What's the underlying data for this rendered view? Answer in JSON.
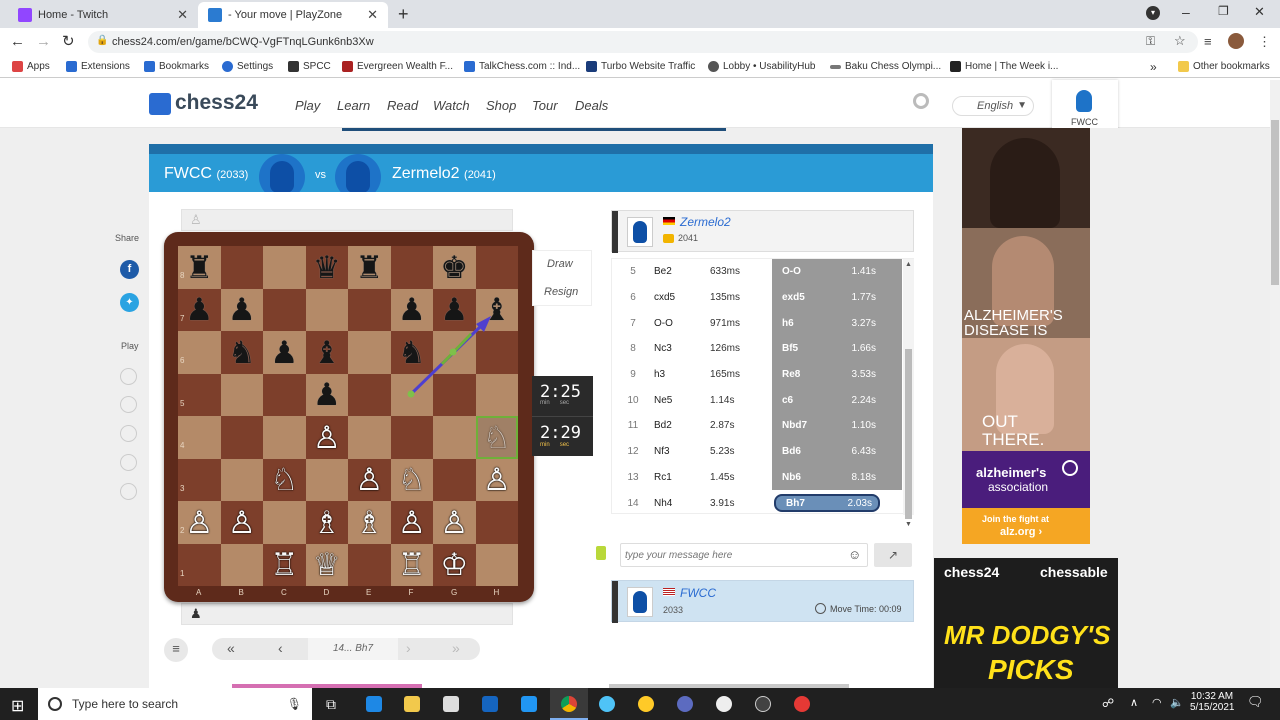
{
  "browser": {
    "tabs": [
      {
        "title": "Home - Twitch",
        "color": "#9146ff"
      },
      {
        "title": "- Your move | PlayZone",
        "color": "#2b7bd1"
      }
    ],
    "new_tab": "+",
    "url": "chess24.com/en/game/bCWQ-VgFTnqLGunk6nb3Xw",
    "bookmarks": [
      "Apps",
      "Extensions",
      "Bookmarks",
      "Settings",
      "SPCC",
      "Evergreen Wealth F...",
      "TalkChess.com :: Ind...",
      "Turbo Website Traffic",
      "Lobby • UsabilityHub",
      "Baku Chess Olympi...",
      "Home | The Week i..."
    ],
    "other_bookmarks": "Other bookmarks",
    "overflow": "»"
  },
  "site": {
    "logo": "chess24",
    "nav": [
      "Play",
      "Learn",
      "Read",
      "Watch",
      "Shop",
      "Tour",
      "Deals"
    ],
    "language": "English",
    "user": "FWCC"
  },
  "game": {
    "white": {
      "name": "FWCC",
      "rating": "(2033)"
    },
    "vs": "vs",
    "black": {
      "name": "Zermelo2",
      "rating": "(2041)"
    },
    "actions": [
      "Draw",
      "Resign"
    ],
    "share_label": "Share",
    "play_label": "Play",
    "clock_top": {
      "min": "2",
      "sec": "25"
    },
    "clock_bottom": {
      "min": "2",
      "sec": "29"
    },
    "min_label": "min",
    "sec_label": "sec",
    "current_move": "14... Bh7",
    "files": [
      "A",
      "B",
      "C",
      "D",
      "E",
      "F",
      "G",
      "H"
    ],
    "ranks": [
      "8",
      "7",
      "6",
      "5",
      "4",
      "3",
      "2",
      "1"
    ],
    "board": [
      [
        "br",
        "",
        "",
        "bq",
        "br",
        "",
        "bk",
        ""
      ],
      [
        "bp",
        "bp",
        "",
        "",
        "",
        "bp",
        "bp",
        "bb"
      ],
      [
        "",
        "bn",
        "bp",
        "bb",
        "",
        "bn",
        "",
        ""
      ],
      [
        "",
        "",
        "",
        "bp",
        "",
        "",
        "",
        ""
      ],
      [
        "",
        "",
        "",
        "wp",
        "",
        "",
        "",
        "wn"
      ],
      [
        "",
        "",
        "wn",
        "",
        "wp",
        "wn",
        "",
        "wp"
      ],
      [
        "wp",
        "wp",
        "",
        "wb",
        "wb",
        "wp",
        "wp",
        ""
      ],
      [
        "",
        "",
        "wr",
        "wq",
        "",
        "wr",
        "wk",
        ""
      ]
    ],
    "opponent": {
      "name": "Zermelo2",
      "rating": "2041"
    },
    "me": {
      "name": "FWCC",
      "rating": "2033",
      "move_time_label": "Move Time: 00:09"
    },
    "chat_placeholder": "type your message here",
    "moves": [
      {
        "n": "5",
        "w": "Be2",
        "wt": "633ms",
        "b": "O-O",
        "bt": "1.41s"
      },
      {
        "n": "6",
        "w": "cxd5",
        "wt": "135ms",
        "b": "exd5",
        "bt": "1.77s"
      },
      {
        "n": "7",
        "w": "O-O",
        "wt": "971ms",
        "b": "h6",
        "bt": "3.27s"
      },
      {
        "n": "8",
        "w": "Nc3",
        "wt": "126ms",
        "b": "Bf5",
        "bt": "1.66s"
      },
      {
        "n": "9",
        "w": "h3",
        "wt": "165ms",
        "b": "Re8",
        "bt": "3.53s"
      },
      {
        "n": "10",
        "w": "Ne5",
        "wt": "1.14s",
        "b": "c6",
        "bt": "2.24s"
      },
      {
        "n": "11",
        "w": "Bd2",
        "wt": "2.87s",
        "b": "Nbd7",
        "bt": "1.10s"
      },
      {
        "n": "12",
        "w": "Nf3",
        "wt": "5.23s",
        "b": "Bd6",
        "bt": "6.43s"
      },
      {
        "n": "13",
        "w": "Rc1",
        "wt": "1.45s",
        "b": "Nb6",
        "bt": "8.18s"
      },
      {
        "n": "14",
        "w": "Nh4",
        "wt": "3.91s",
        "b": "Bh7",
        "bt": "2.03s"
      }
    ]
  },
  "ads": {
    "alz1": "ALZHEIMER'S DISEASE IS",
    "alz2": "OUT THERE.",
    "alz_brand1": "alzheimer's",
    "alz_brand2": "association",
    "alz_cta1": "Join the fight at",
    "alz_cta2": "alz.org ›",
    "chess24": "chess24",
    "chessable": "chessable",
    "dodgy1": "MR DODGY'S",
    "dodgy2": "PICKS"
  },
  "taskbar": {
    "search_placeholder": "Type here to search",
    "time": "10:32 AM",
    "date": "5/15/2021"
  }
}
